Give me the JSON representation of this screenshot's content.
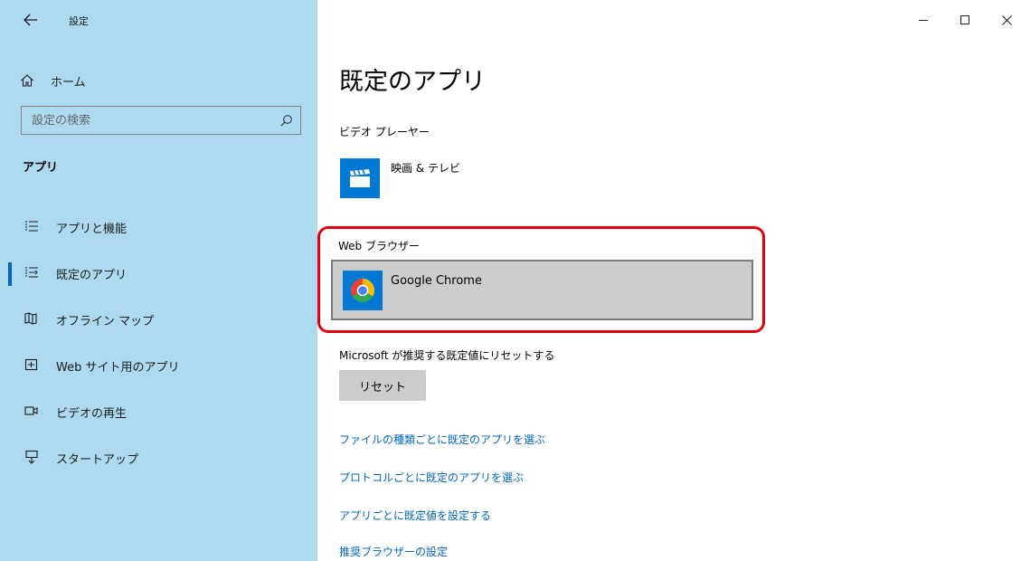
{
  "window": {
    "title": "設定",
    "controls": {
      "minimize": "–",
      "maximize": "□",
      "close": "✕"
    }
  },
  "sidebar": {
    "home_label": "ホーム",
    "search": {
      "placeholder": "設定の検索",
      "value": ""
    },
    "section_label": "アプリ",
    "items": [
      {
        "label": "アプリと機能",
        "icon": "list-icon",
        "selected": false
      },
      {
        "label": "既定のアプリ",
        "icon": "default-apps-icon",
        "selected": true
      },
      {
        "label": "オフライン マップ",
        "icon": "map-icon",
        "selected": false
      },
      {
        "label": "Web サイト用のアプリ",
        "icon": "web-app-icon",
        "selected": false
      },
      {
        "label": "ビデオの再生",
        "icon": "video-icon",
        "selected": false
      },
      {
        "label": "スタートアップ",
        "icon": "startup-icon",
        "selected": false
      }
    ]
  },
  "main": {
    "page_title": "既定のアプリ",
    "video_player": {
      "heading": "ビデオ プレーヤー",
      "app_name": "映画 & テレビ",
      "app_icon": "movies-tv-icon"
    },
    "web_browser": {
      "heading": "Web ブラウザー",
      "app_name": "Google Chrome",
      "app_icon": "chrome-icon"
    },
    "reset": {
      "description": "Microsoft が推奨する既定値にリセットする",
      "button_label": "リセット"
    },
    "links": [
      "ファイルの種類ごとに既定のアプリを選ぶ",
      "プロトコルごとに既定のアプリを選ぶ",
      "アプリごとに既定値を設定する",
      "推奨ブラウザーの設定"
    ]
  },
  "colors": {
    "sidebar_bg": "#addaf0",
    "accent": "#0067c0",
    "highlight": "#e0000f",
    "tile_bg": "#cccccc"
  }
}
